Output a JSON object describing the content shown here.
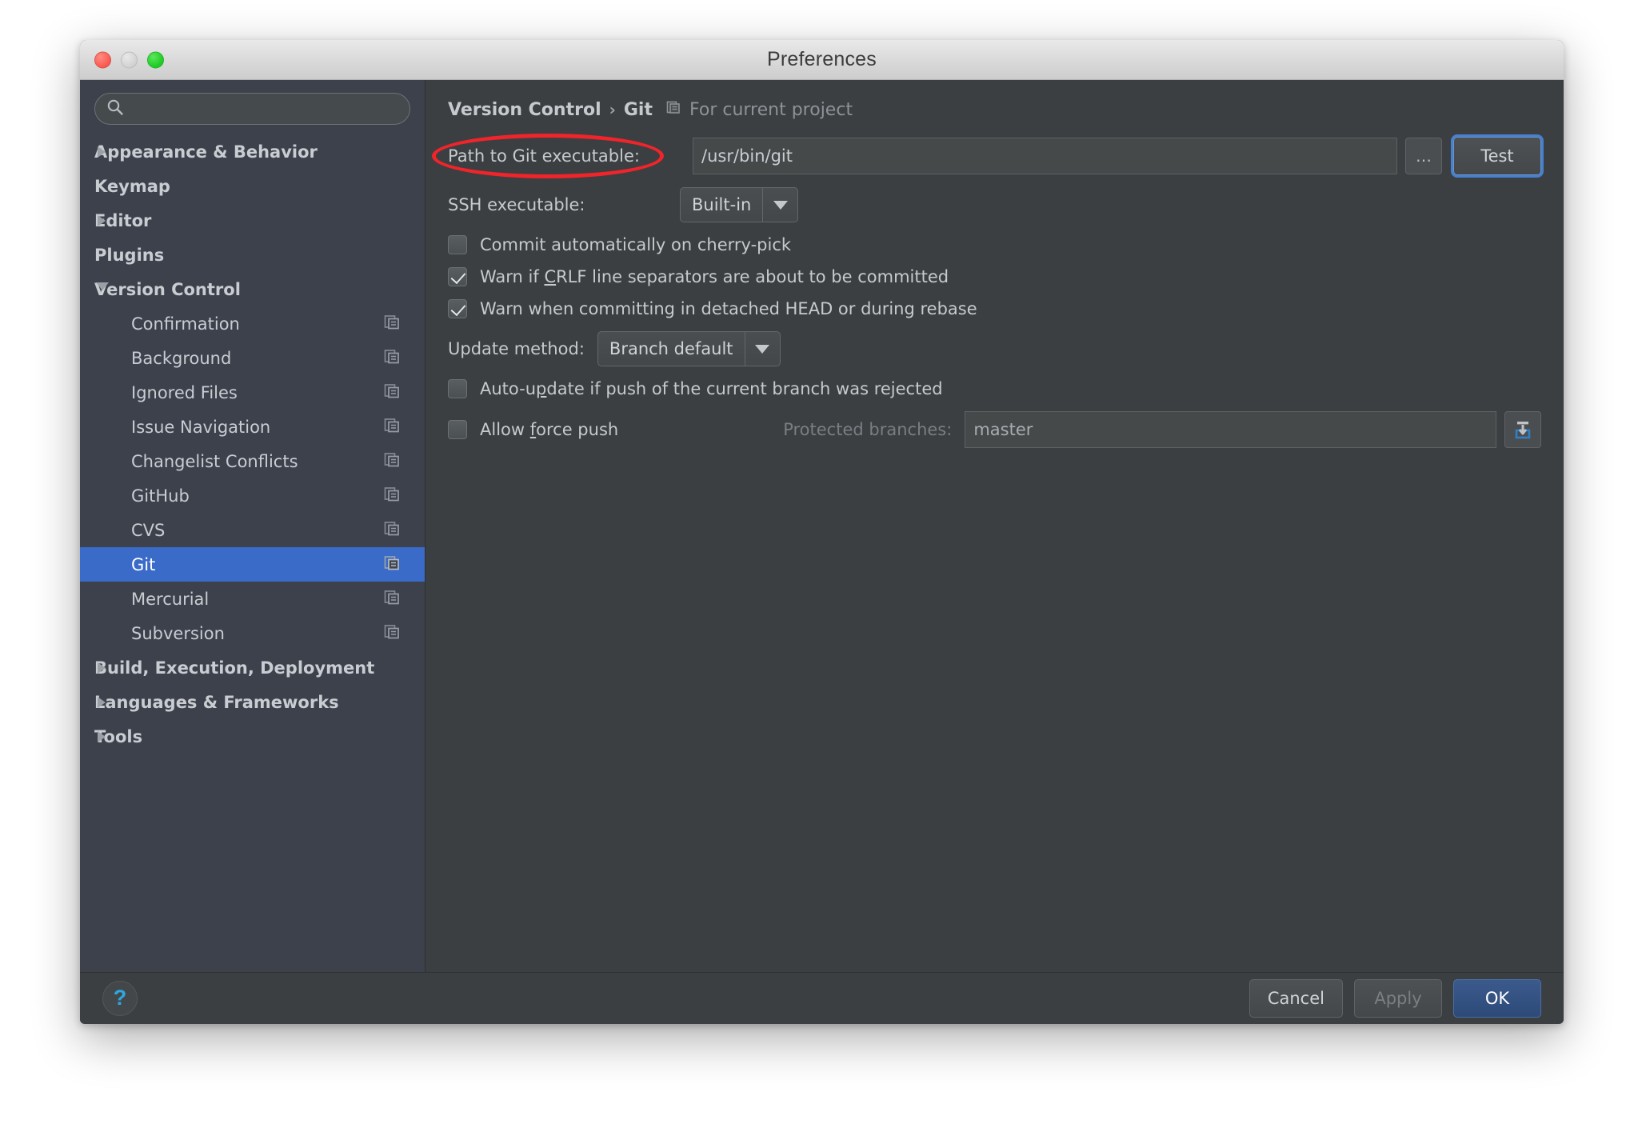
{
  "window": {
    "title": "Preferences",
    "traffic_lights": [
      "close",
      "minimize",
      "zoom"
    ]
  },
  "sidebar": {
    "search": {
      "value": "",
      "placeholder": ""
    },
    "items": [
      {
        "label": "Appearance & Behavior",
        "level": 0,
        "twisty": "collapsed",
        "bold": true,
        "project_icon": false,
        "selected": false
      },
      {
        "label": "Keymap",
        "level": 0,
        "twisty": "none",
        "bold": true,
        "project_icon": false,
        "selected": false
      },
      {
        "label": "Editor",
        "level": 0,
        "twisty": "collapsed",
        "bold": true,
        "project_icon": false,
        "selected": false
      },
      {
        "label": "Plugins",
        "level": 0,
        "twisty": "none",
        "bold": true,
        "project_icon": false,
        "selected": false
      },
      {
        "label": "Version Control",
        "level": 0,
        "twisty": "expanded",
        "bold": true,
        "project_icon": false,
        "selected": false
      },
      {
        "label": "Confirmation",
        "level": 1,
        "twisty": "none",
        "bold": false,
        "project_icon": true,
        "selected": false
      },
      {
        "label": "Background",
        "level": 1,
        "twisty": "none",
        "bold": false,
        "project_icon": true,
        "selected": false
      },
      {
        "label": "Ignored Files",
        "level": 1,
        "twisty": "none",
        "bold": false,
        "project_icon": true,
        "selected": false
      },
      {
        "label": "Issue Navigation",
        "level": 1,
        "twisty": "none",
        "bold": false,
        "project_icon": true,
        "selected": false
      },
      {
        "label": "Changelist Conflicts",
        "level": 1,
        "twisty": "none",
        "bold": false,
        "project_icon": true,
        "selected": false
      },
      {
        "label": "GitHub",
        "level": 1,
        "twisty": "none",
        "bold": false,
        "project_icon": true,
        "selected": false
      },
      {
        "label": "CVS",
        "level": 1,
        "twisty": "none",
        "bold": false,
        "project_icon": true,
        "selected": false
      },
      {
        "label": "Git",
        "level": 1,
        "twisty": "none",
        "bold": false,
        "project_icon": true,
        "selected": true
      },
      {
        "label": "Mercurial",
        "level": 1,
        "twisty": "none",
        "bold": false,
        "project_icon": true,
        "selected": false
      },
      {
        "label": "Subversion",
        "level": 1,
        "twisty": "none",
        "bold": false,
        "project_icon": true,
        "selected": false
      },
      {
        "label": "Build, Execution, Deployment",
        "level": 0,
        "twisty": "collapsed",
        "bold": true,
        "project_icon": false,
        "selected": false
      },
      {
        "label": "Languages & Frameworks",
        "level": 0,
        "twisty": "collapsed",
        "bold": true,
        "project_icon": false,
        "selected": false
      },
      {
        "label": "Tools",
        "level": 0,
        "twisty": "collapsed",
        "bold": true,
        "project_icon": false,
        "selected": false
      }
    ]
  },
  "content": {
    "breadcrumb": {
      "parent": "Version Control",
      "separator": "›",
      "current": "Git",
      "scope": "For current project"
    },
    "path_row": {
      "label": "Path to Git executable:",
      "value": "/usr/bin/git",
      "browse_label": "…",
      "test_label": "Test",
      "annotated": true
    },
    "ssh_row": {
      "label": "SSH executable:",
      "value": "Built-in"
    },
    "checkboxes": [
      {
        "label": "Commit automatically on cherry-pick",
        "checked": false,
        "mnemonic": ""
      },
      {
        "label": "Warn if CRLF line separators are about to be committed",
        "checked": true,
        "mnemonic": "C"
      },
      {
        "label": "Warn when committing in detached HEAD or during rebase",
        "checked": true,
        "mnemonic": ""
      }
    ],
    "update_row": {
      "label": "Update method:",
      "value": "Branch default"
    },
    "autoupdate_row": {
      "label": "Auto-update if push of the current branch was rejected",
      "checked": false,
      "mnemonic": "p"
    },
    "force_row": {
      "label": "Allow force push",
      "checked": false,
      "mnemonic": "f",
      "protected_label": "Protected branches:",
      "protected_value": "master",
      "protected_disabled": true,
      "import_icon": "import-into-box-icon"
    }
  },
  "footer": {
    "help_label": "?",
    "cancel_label": "Cancel",
    "apply_label": "Apply",
    "apply_disabled": true,
    "ok_label": "OK"
  },
  "colors": {
    "window_bg": "#3c3f41",
    "sidebar_bg": "#3c414c",
    "selection": "#3a6bc9",
    "accent_ok": "#2d4a78",
    "annotation_red": "#f0242a",
    "help_blue": "#2ea8e0",
    "text": "#c6c9ce",
    "text_dim": "#797e84"
  }
}
